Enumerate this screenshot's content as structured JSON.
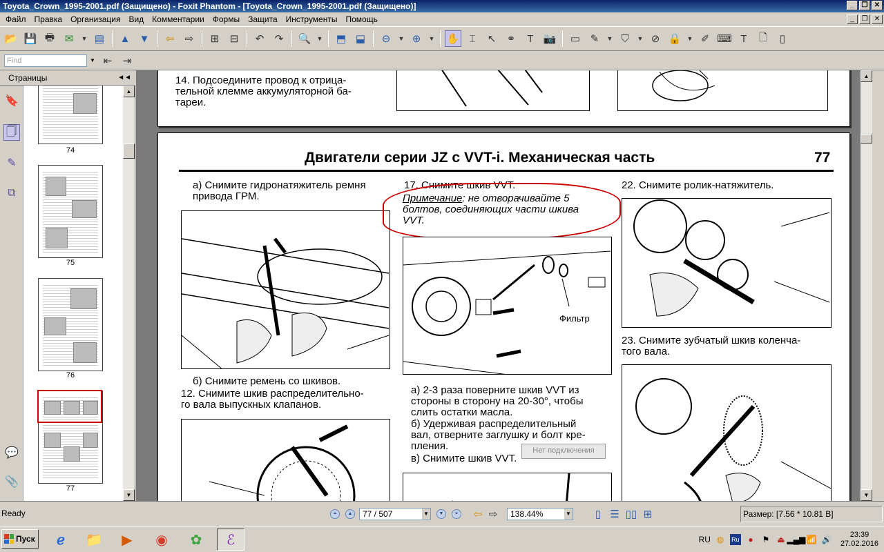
{
  "window": {
    "title": "Toyota_Crown_1995-2001.pdf (Защищено) - Foxit Phantom - [Toyota_Crown_1995-2001.pdf (Защищено)]"
  },
  "menu": [
    "Файл",
    "Правка",
    "Организация",
    "Вид",
    "Комментарии",
    "Формы",
    "Защита",
    "Инструменты",
    "Помощь"
  ],
  "find": {
    "placeholder": "Find"
  },
  "sidebar": {
    "title": "Страницы",
    "thumbnails": [
      {
        "label": "74"
      },
      {
        "label": "75"
      },
      {
        "label": "76"
      },
      {
        "label": "77",
        "selected": true
      }
    ]
  },
  "document": {
    "top_page": {
      "step14": "14. Подсоедините провод к отрица-\nтельной клемме аккумуляторной ба-\nтареи."
    },
    "page77": {
      "header_title": "Двигатели серии JZ с VVT-i. Механическая часть",
      "page_number": "77",
      "col1_a": "а) Снимите гидронатяжитель ремня\nпривода ГРМ.",
      "col1_b": "б) Снимите ремень со шкивов.",
      "col1_12": "12. Снимите шкив распределительно-\nго вала выпускных клапанов.",
      "col2_17": "17. Снимите шкив VVT.",
      "note_label": "Примечание",
      "note_text": ": не отворачивайте 5\nболтов, соединяющих части шкива\nVVT.",
      "filter_label": "Фильтр",
      "col2_a": "а) 2-3 раза поверните шкив VVT из\nстороны в сторону на 20-30°, чтобы\nслить остатки масла.",
      "col2_b": "б) Удерживая распределительный\nвал, отверните заглушку и болт кре-\nпления.",
      "col2_v": "в) Снимите шкив VVT.",
      "col3_22": "22. Снимите ролик-натяжитель.",
      "col3_23": "23. Снимите зубчатый шкив коленча-\nтого вала."
    },
    "tooltip": "Нет подключения"
  },
  "status": {
    "ready": "Ready",
    "page": "77 / 507",
    "zoom": "138.44%",
    "size": "Размер: [7.56 * 10.81 В]"
  },
  "taskbar": {
    "start": "Пуск",
    "lang": "RU",
    "time": "23:39",
    "date": "27.02.2016"
  }
}
